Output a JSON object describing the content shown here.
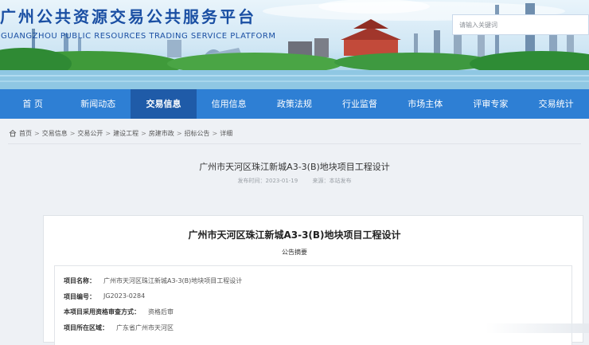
{
  "header": {
    "site_title": "广州公共资源交易公共服务平台",
    "site_subtitle": "GUANGZHOU PUBLIC RESOURCES TRADING SERVICE PLATFORM",
    "search_placeholder": "请输入关键词"
  },
  "nav": {
    "items": [
      {
        "label": "首 页"
      },
      {
        "label": "新闻动态"
      },
      {
        "label": "交易信息"
      },
      {
        "label": "信用信息"
      },
      {
        "label": "政策法规"
      },
      {
        "label": "行业监督"
      },
      {
        "label": "市场主体"
      },
      {
        "label": "评审专家"
      },
      {
        "label": "交易统计"
      }
    ],
    "active_index": 2
  },
  "breadcrumb": {
    "items": [
      "首页",
      "交易信息",
      "交易公开",
      "建设工程",
      "房建市政",
      "招标公告",
      "详细"
    ]
  },
  "article": {
    "title": "广州市天河区珠江新城A3-3(B)地块项目工程设计",
    "publish_time": "发布时间：2023-01-19",
    "source": "来源：本站发布"
  },
  "notice": {
    "title": "广州市天河区珠江新城A3-3(B)地块项目工程设计",
    "subtitle": "公告摘要",
    "rows": [
      {
        "key": "项目名称：",
        "value": "广州市天河区珠江新城A3-3(B)地块项目工程设计"
      },
      {
        "key": "项目编号：",
        "value": "JG2023-0284"
      },
      {
        "key": "本项目采用资格审查方式：",
        "value": "资格后审"
      },
      {
        "key": "项目所在区域：",
        "value": "广东省广州市天河区"
      }
    ]
  },
  "colors": {
    "nav_bg": "#2e7fd4",
    "nav_active": "#1f5ba8",
    "title_blue": "#1a4fa3"
  }
}
